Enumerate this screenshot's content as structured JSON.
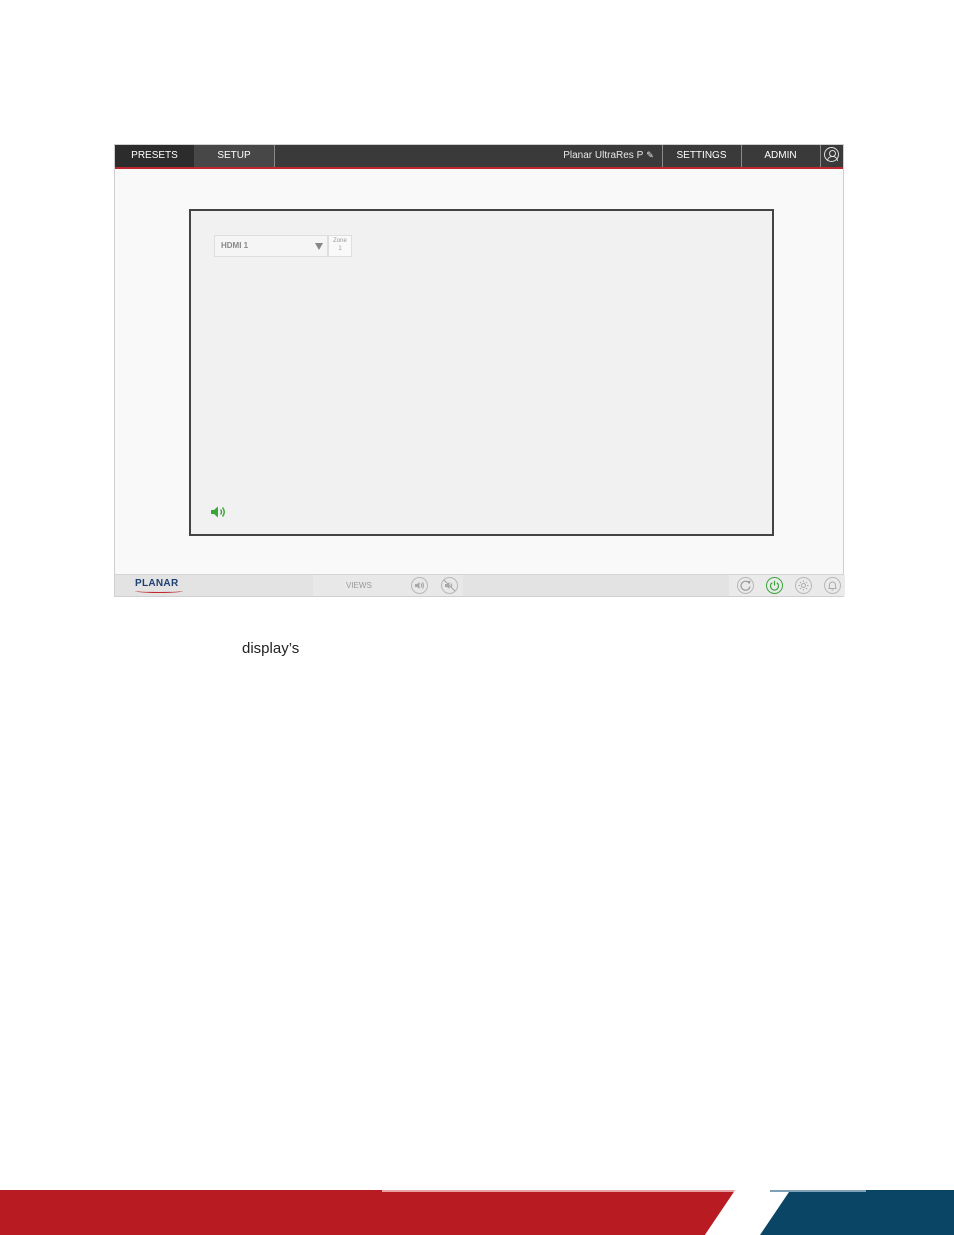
{
  "topbar": {
    "tabs": [
      {
        "label": "PRESETS"
      },
      {
        "label": "SETUP"
      }
    ],
    "device_name": "Planar UltraRes P",
    "settings_label": "SETTINGS",
    "admin_label": "ADMIN"
  },
  "main": {
    "source_select": {
      "value": "HDMI 1"
    },
    "zone": {
      "label": "Zone",
      "number": "1"
    }
  },
  "bottombar": {
    "logo": "PLANAR",
    "views_label": "VIEWS"
  },
  "caption": {
    "text": "display’s"
  },
  "colors": {
    "accent_red": "#c0272d",
    "brand_navy": "#0a4566",
    "power_green": "#3aa63a",
    "volume_green": "#3aa63a"
  },
  "icons": {
    "edit": "pencil-icon",
    "user": "user-icon",
    "volume": "volume-icon",
    "mute": "mute-icon",
    "refresh": "refresh-icon",
    "power": "power-icon",
    "brightness": "brightness-icon",
    "alarm": "alarm-icon"
  }
}
